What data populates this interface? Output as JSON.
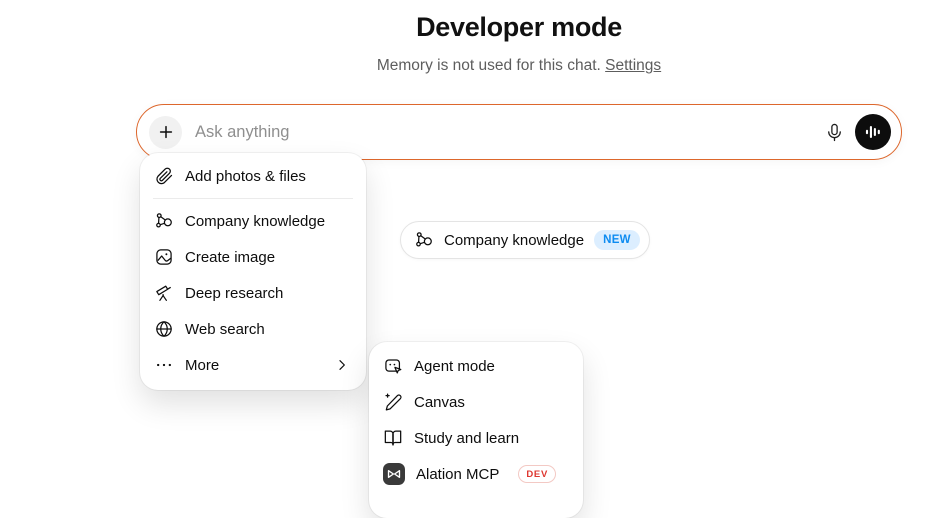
{
  "header": {
    "title": "Developer mode",
    "subtitle": "Memory is not used for this chat.",
    "settings_link": "Settings"
  },
  "composer": {
    "placeholder": "Ask anything",
    "icons": [
      "plus-icon",
      "microphone-icon",
      "voice-waveform-icon"
    ]
  },
  "attach_menu": {
    "items": [
      {
        "label": "Add photos & files",
        "icon": "paperclip-icon"
      },
      {
        "label": "Company knowledge",
        "icon": "knowledge-network-icon"
      },
      {
        "label": "Create image",
        "icon": "image-icon"
      },
      {
        "label": "Deep research",
        "icon": "telescope-icon"
      },
      {
        "label": "Web search",
        "icon": "globe-icon"
      },
      {
        "label": "More",
        "icon": "ellipsis-icon",
        "has_submenu": true
      }
    ]
  },
  "knowledge_chip": {
    "label": "Company knowledge",
    "badge": "NEW",
    "icon": "knowledge-network-icon"
  },
  "more_submenu": {
    "items": [
      {
        "label": "Agent mode",
        "icon": "agent-face-cursor-icon"
      },
      {
        "label": "Canvas",
        "icon": "pen-sparkle-icon"
      },
      {
        "label": "Study and learn",
        "icon": "open-book-icon"
      },
      {
        "label": "Alation MCP",
        "icon": "alation-logo-icon",
        "badge": "DEV"
      }
    ]
  },
  "colors": {
    "accent_orange": "#dd672c",
    "voice_button_bg": "#0d0d0d",
    "badge_new_bg": "#dceeff",
    "badge_new_text": "#0e8cf1",
    "badge_dev_text": "#de3730",
    "badge_dev_border": "#f3c9c4",
    "subtitle_gray": "#5d5d5d",
    "placeholder_gray": "#8f8f8f"
  }
}
